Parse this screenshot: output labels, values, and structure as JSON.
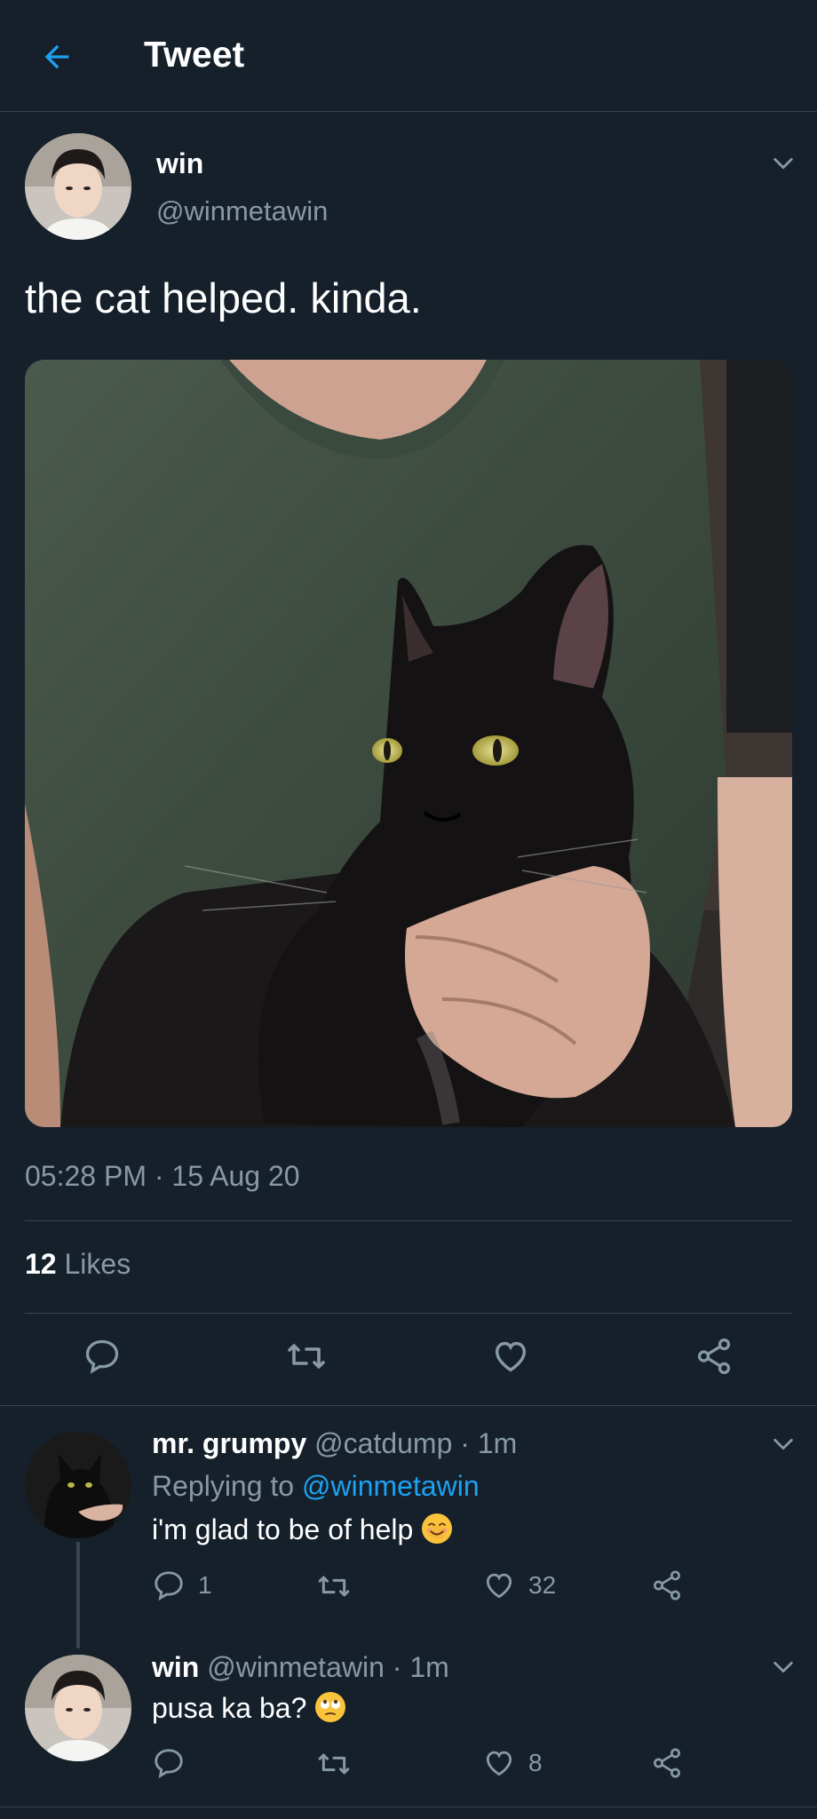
{
  "header": {
    "title": "Tweet"
  },
  "tweet": {
    "author_name": "win",
    "author_handle": "@winmetawin",
    "text": "the cat helped. kinda.",
    "timestamp": "05:28 PM · 15 Aug 20",
    "likes_count": "12",
    "likes_label": "Likes"
  },
  "replies": [
    {
      "name": "mr. grumpy",
      "handle": "@catdump",
      "time": "· 1m",
      "replying_label": "Replying to",
      "replying_to": "@winmetawin",
      "text": "i'm glad to be of help",
      "reply_count": "1",
      "like_count": "32"
    },
    {
      "name": "win",
      "handle": "@winmetawin",
      "time": "· 1m",
      "text": "pusa ka ba?",
      "like_count": "8"
    }
  ],
  "colors": {
    "background": "#15202b",
    "accent": "#1da1f2",
    "secondary_text": "#8899a6",
    "border": "#38444d"
  },
  "icons": [
    "back-arrow-icon",
    "chevron-down-icon",
    "reply-icon",
    "retweet-icon",
    "like-icon",
    "share-icon"
  ]
}
